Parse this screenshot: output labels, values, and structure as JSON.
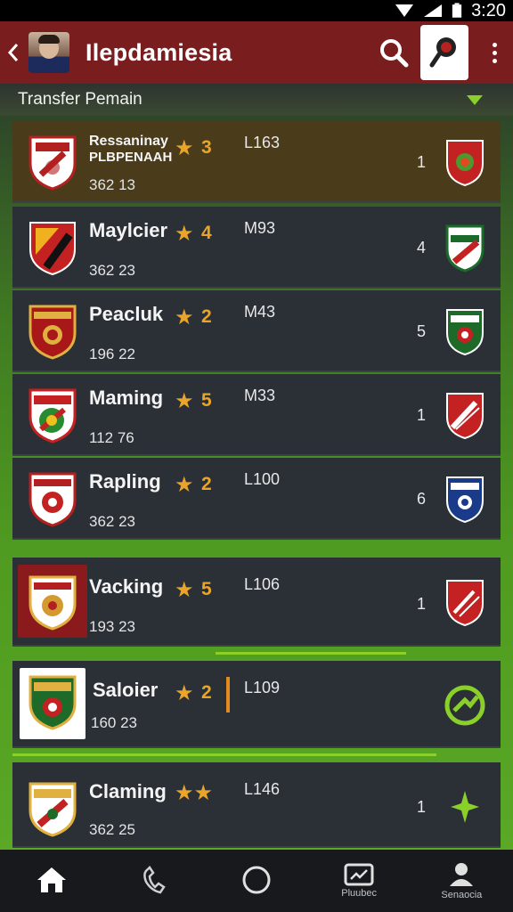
{
  "status_bar": {
    "time": "3:20"
  },
  "app_bar": {
    "title": "Ilepdamiesia",
    "back_icon": "chevron-left-icon",
    "search_icon": "search-icon",
    "pin_icon": "map-pin-icon",
    "more_icon": "more-vert-icon"
  },
  "section": {
    "title": "Transfer Pemain"
  },
  "rows": [
    {
      "name_line1": "Ressaninay",
      "name_line2": "PLBPENAAH",
      "stars": "★",
      "rating": "3",
      "stats": "362 13",
      "value": "L163",
      "rank": "1",
      "highlight": true
    },
    {
      "name": "Maylcier",
      "stars": "★",
      "rating": "4",
      "stats": "362 23",
      "value": "M93",
      "rank": "4"
    },
    {
      "name": "Peacluk",
      "stars": "★",
      "rating": "2",
      "stats": "196 22",
      "value": "M43",
      "rank": "5"
    },
    {
      "name": "Maming",
      "stars": "★",
      "rating": "5",
      "stats": "112 76",
      "value": "M33",
      "rank": "1"
    },
    {
      "name": "Rapling",
      "stars": "★",
      "rating": "2",
      "stats": "362 23",
      "value": "L100",
      "rank": "6"
    },
    {
      "name": "Vacking",
      "stars": "★",
      "rating": "5",
      "stats": "193 23",
      "value": "L106",
      "rank": "1"
    },
    {
      "name": "Saloier",
      "stars": "★",
      "rating": "2",
      "stats": "160 23",
      "value": "L109",
      "rank": ""
    },
    {
      "name": "Claming",
      "stars": "★★",
      "rating": "",
      "stats": "362 25",
      "value": "L146",
      "rank": "1"
    }
  ],
  "bottom_nav": [
    {
      "label": "",
      "icon": "home-icon"
    },
    {
      "label": "",
      "icon": "phone-icon"
    },
    {
      "label": "",
      "icon": "circle-icon"
    },
    {
      "label": "Pluubec",
      "icon": "card-icon"
    },
    {
      "label": "Senaocia",
      "icon": "person-icon"
    }
  ],
  "colors": {
    "app_bar": "#7a1d1f",
    "accent": "#8bcf2a",
    "star": "#e9a42a"
  }
}
